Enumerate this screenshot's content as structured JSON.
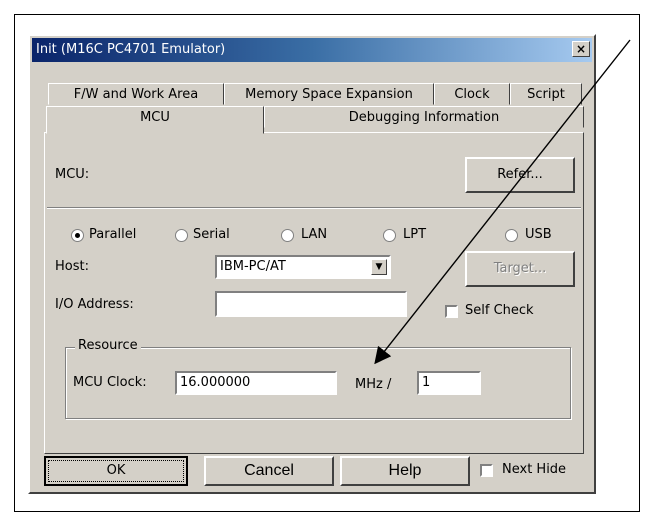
{
  "window": {
    "title": "Init (M16C PC4701 Emulator)",
    "close_glyph": "×"
  },
  "tabs": {
    "row1": [
      "F/W and Work Area",
      "Memory Space Expansion",
      "Clock",
      "Script"
    ],
    "row2": [
      "MCU",
      "Debugging Information"
    ],
    "active": "MCU"
  },
  "mcu": {
    "label": "MCU:",
    "refer_button": "Refer..."
  },
  "connection": {
    "options": [
      "Parallel",
      "Serial",
      "LAN",
      "LPT",
      "USB"
    ],
    "selected": "Parallel"
  },
  "host": {
    "label": "Host:",
    "value": "IBM-PC/AT",
    "target_button": "Target..."
  },
  "io_address": {
    "label": "I/O Address:",
    "value": "",
    "self_check_label": "Self Check",
    "self_check_checked": false
  },
  "resource": {
    "group_label": "Resource",
    "mcu_clock_label": "MCU Clock:",
    "mcu_clock_value": "16.000000",
    "unit_label": "MHz /",
    "divider_value": "1"
  },
  "footer": {
    "ok": "OK",
    "cancel": "Cancel",
    "help": "Help",
    "next_hide_label": "Next Hide",
    "next_hide_checked": false
  }
}
